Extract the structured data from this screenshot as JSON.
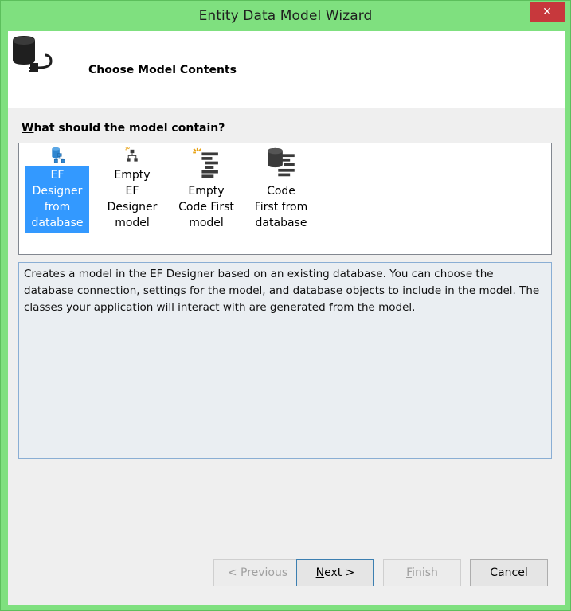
{
  "window": {
    "title": "Entity Data Model Wizard",
    "close_glyph": "✕"
  },
  "header": {
    "title": "Choose Model Contents",
    "icon": "database-connect-icon"
  },
  "question": {
    "accesskey": "W",
    "rest": "hat should the model contain?"
  },
  "options": [
    {
      "label": "EF Designer from database",
      "icon": "ef-designer-database-icon",
      "selected": true
    },
    {
      "label": "Empty EF Designer model",
      "icon": "empty-ef-designer-icon",
      "selected": false
    },
    {
      "label": "Empty Code First model",
      "icon": "empty-code-first-icon",
      "selected": false
    },
    {
      "label": "Code First from database",
      "icon": "code-first-database-icon",
      "selected": false
    }
  ],
  "description": "Creates a model in the EF Designer based on an existing database. You can choose the database connection, settings for the model, and database objects to include in the model. The classes your application will interact with are generated from the model.",
  "buttons": {
    "previous": "< Previous",
    "next_accesskey": "N",
    "next_rest": "ext >",
    "finish_accesskey": "F",
    "finish_rest": "inish",
    "cancel": "Cancel"
  },
  "colors": {
    "titlebar": "#7fe07f",
    "close": "#c7383c",
    "selection": "#3399ff",
    "icon_blue": "#2f86d0"
  }
}
